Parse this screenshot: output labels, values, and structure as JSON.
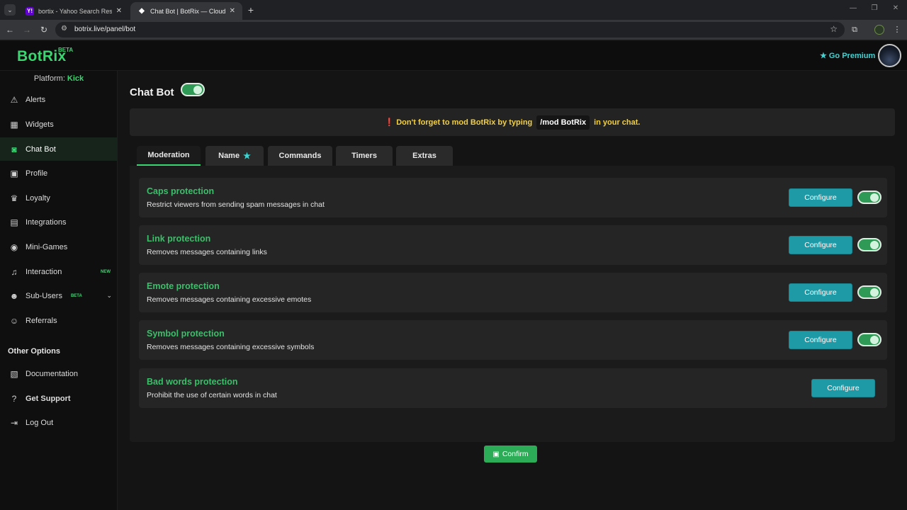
{
  "browser": {
    "tabs": [
      {
        "title": "bortix - Yahoo Search Results",
        "favicon": "Y!"
      },
      {
        "title": "Chat Bot | BotRix — Cloud Strea",
        "favicon": "◆"
      }
    ],
    "url": "botrix.live/panel/bot"
  },
  "app": {
    "logo": "BotRix",
    "logo_badge": "BETA",
    "premium_label": "Go Premium",
    "accent_color": "#3bd672",
    "premium_color": "#3ed4d4"
  },
  "sidebar": {
    "platform_label": "Platform:",
    "platform_value": "Kick",
    "items": [
      {
        "label": "Alerts",
        "icon": "warning-icon"
      },
      {
        "label": "Widgets",
        "icon": "widgets-icon"
      },
      {
        "label": "Chat Bot",
        "icon": "robot-icon",
        "active": true
      },
      {
        "label": "Profile",
        "icon": "id-card-icon"
      },
      {
        "label": "Loyalty",
        "icon": "trophy-icon"
      },
      {
        "label": "Integrations",
        "icon": "integrations-icon"
      },
      {
        "label": "Mini-Games",
        "icon": "gamepad-icon"
      },
      {
        "label": "Interaction",
        "icon": "music-icon",
        "badge": "NEW"
      },
      {
        "label": "Sub-Users",
        "icon": "users-icon",
        "badge": "BETA"
      },
      {
        "label": "Referrals",
        "icon": "referrals-icon"
      }
    ],
    "other_options_title": "Other Options",
    "other_items": [
      {
        "label": "Documentation",
        "icon": "scroll-icon"
      },
      {
        "label": "Get Support",
        "icon": "question-icon"
      },
      {
        "label": "Log Out",
        "icon": "logout-icon"
      }
    ]
  },
  "main": {
    "title": "Chat Bot",
    "notice": {
      "before": "Don't forget to mod BotRix by typing",
      "command": "/mod BotRix",
      "after": "in your chat."
    },
    "tabs": [
      {
        "label": "Moderation",
        "active": true
      },
      {
        "label": "Name",
        "icon": "star-icon"
      },
      {
        "label": "Commands"
      },
      {
        "label": "Timers"
      },
      {
        "label": "Extras"
      }
    ],
    "rules": [
      {
        "title": "Caps protection",
        "description": "Restrict viewers from sending spam messages in chat",
        "button": "Configure",
        "enabled": true
      },
      {
        "title": "Link protection",
        "description": "Removes messages containing links",
        "button": "Configure",
        "enabled": true
      },
      {
        "title": "Emote protection",
        "description": "Removes messages containing excessive emotes",
        "button": "Configure",
        "enabled": true
      },
      {
        "title": "Symbol protection",
        "description": "Removes messages containing excessive symbols",
        "button": "Configure",
        "enabled": true
      },
      {
        "title": "Bad words protection",
        "description": "Prohibit the use of certain words in chat",
        "button": "Configure"
      }
    ],
    "confirm_label": "Confirm"
  }
}
